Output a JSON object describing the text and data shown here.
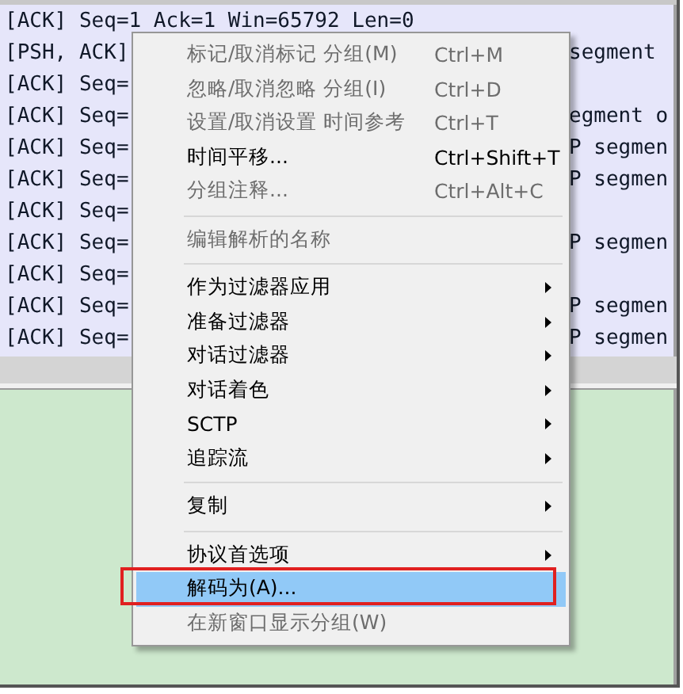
{
  "packet_list": {
    "rows": [
      {
        "info": "[ACK] Seq=1 Ack=1 Win=65792 Len=0",
        "tail": ""
      },
      {
        "info": "[PSH, ACK]",
        "tail": "segment"
      },
      {
        "info": "[ACK] Seq=",
        "tail": ""
      },
      {
        "info": "[ACK] Seq=",
        "tail": "egment o"
      },
      {
        "info": "[ACK] Seq=",
        "tail": "P segmen"
      },
      {
        "info": "[ACK] Seq=",
        "tail": "P segmen"
      },
      {
        "info": "[ACK] Seq=",
        "tail": ""
      },
      {
        "info": "[ACK] Seq=",
        "tail": "P segmen"
      },
      {
        "info": "[ACK] Seq=",
        "tail": ""
      },
      {
        "info": "[ACK] Seq=",
        "tail": "P segmen"
      },
      {
        "info": "[ACK] Seq=",
        "tail": "P segmen"
      }
    ]
  },
  "context_menu": {
    "entries": [
      {
        "kind": "item",
        "label": "标记/取消标记 分组(M)",
        "shortcut": "Ctrl+M",
        "disabled": true,
        "submenu": false,
        "selected": false,
        "outlined": false
      },
      {
        "kind": "item",
        "label": "忽略/取消忽略 分组(I)",
        "shortcut": "Ctrl+D",
        "disabled": true,
        "submenu": false,
        "selected": false,
        "outlined": false
      },
      {
        "kind": "item",
        "label": "设置/取消设置 时间参考",
        "shortcut": "Ctrl+T",
        "disabled": true,
        "submenu": false,
        "selected": false,
        "outlined": false
      },
      {
        "kind": "item",
        "label": "时间平移...",
        "shortcut": "Ctrl+Shift+T",
        "disabled": false,
        "submenu": false,
        "selected": false,
        "outlined": false
      },
      {
        "kind": "item",
        "label": "分组注释...",
        "shortcut": "Ctrl+Alt+C",
        "disabled": true,
        "submenu": false,
        "selected": false,
        "outlined": false
      },
      {
        "kind": "separator"
      },
      {
        "kind": "item",
        "label": "编辑解析的名称",
        "disabled": true,
        "submenu": false,
        "selected": false,
        "outlined": false
      },
      {
        "kind": "separator"
      },
      {
        "kind": "item",
        "label": "作为过滤器应用",
        "disabled": false,
        "submenu": true,
        "selected": false,
        "outlined": false
      },
      {
        "kind": "item",
        "label": "准备过滤器",
        "disabled": false,
        "submenu": true,
        "selected": false,
        "outlined": false
      },
      {
        "kind": "item",
        "label": "对话过滤器",
        "disabled": false,
        "submenu": true,
        "selected": false,
        "outlined": false
      },
      {
        "kind": "item",
        "label": "对话着色",
        "disabled": false,
        "submenu": true,
        "selected": false,
        "outlined": false
      },
      {
        "kind": "item",
        "label": "SCTP",
        "disabled": false,
        "submenu": true,
        "selected": false,
        "outlined": false
      },
      {
        "kind": "item",
        "label": "追踪流",
        "disabled": false,
        "submenu": true,
        "selected": false,
        "outlined": false
      },
      {
        "kind": "separator"
      },
      {
        "kind": "item",
        "label": "复制",
        "disabled": false,
        "submenu": true,
        "selected": false,
        "outlined": false
      },
      {
        "kind": "separator"
      },
      {
        "kind": "item",
        "label": "协议首选项",
        "disabled": false,
        "submenu": true,
        "selected": false,
        "outlined": false
      },
      {
        "kind": "item",
        "label": "解码为(A)...",
        "disabled": false,
        "submenu": false,
        "selected": true,
        "outlined": true
      },
      {
        "kind": "item",
        "label": "在新窗口显示分组(W)",
        "disabled": true,
        "submenu": false,
        "selected": false,
        "outlined": false
      }
    ]
  }
}
